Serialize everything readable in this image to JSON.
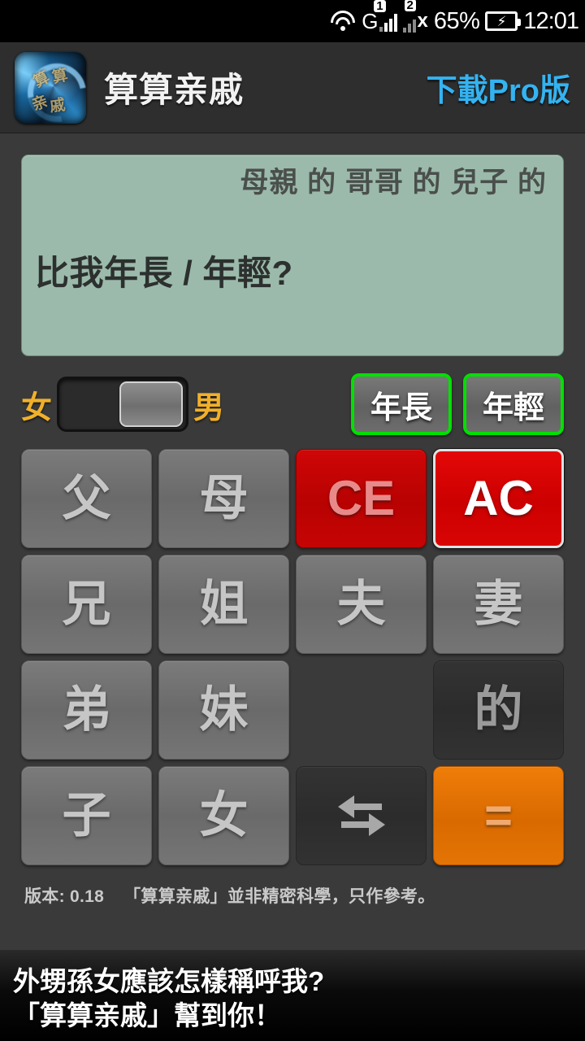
{
  "status_bar": {
    "wifi_icon": "wifi-icon",
    "sim1_label": "G",
    "sim1_badge": "1",
    "sim2_badge": "2",
    "sim2_no_signal": "x",
    "battery_percent": "65%",
    "battery_icon": "battery-charging-icon",
    "time": "12:01"
  },
  "header": {
    "logo_icon": "app-logo-icon",
    "logo_glyphs": [
      "算",
      "算",
      "亲",
      "戚"
    ],
    "title": "算算亲戚",
    "pro_link": "下載Pro版",
    "pro_link_color": "#34b3f1"
  },
  "display": {
    "expression": "母親 的 哥哥 的 兒子 的",
    "question": "比我年長 / 年輕?",
    "background_color": "#9bbaab",
    "text_color": "#2c302e"
  },
  "controls": {
    "gender_toggle": {
      "left_label": "女",
      "right_label": "男",
      "selected": "男",
      "label_color": "#f0b02a"
    },
    "age_buttons": [
      {
        "label": "年長",
        "name": "age-older-button",
        "border_color": "#00e000"
      },
      {
        "label": "年輕",
        "name": "age-younger-button",
        "border_color": "#00e000"
      }
    ]
  },
  "keypad": {
    "keys": [
      {
        "label": "父",
        "name": "key-father",
        "state": "normal"
      },
      {
        "label": "母",
        "name": "key-mother",
        "state": "normal"
      },
      {
        "label": "CE",
        "name": "key-clear-entry",
        "state": "ce"
      },
      {
        "label": "AC",
        "name": "key-all-clear",
        "state": "ac"
      },
      {
        "label": "兄",
        "name": "key-elder-brother",
        "state": "normal"
      },
      {
        "label": "姐",
        "name": "key-elder-sister",
        "state": "normal"
      },
      {
        "label": "夫",
        "name": "key-husband",
        "state": "normal"
      },
      {
        "label": "妻",
        "name": "key-wife",
        "state": "normal"
      },
      {
        "label": "弟",
        "name": "key-younger-brother",
        "state": "normal"
      },
      {
        "label": "妹",
        "name": "key-younger-sister",
        "state": "normal"
      },
      {
        "label": "",
        "name": "key-empty-slot",
        "state": "blank"
      },
      {
        "label": "的",
        "name": "key-possessive",
        "state": "disabled"
      },
      {
        "label": "子",
        "name": "key-son",
        "state": "normal"
      },
      {
        "label": "女",
        "name": "key-daughter",
        "state": "normal"
      },
      {
        "label": "",
        "name": "key-swap",
        "state": "disabled",
        "icon": "swap-arrows-icon"
      },
      {
        "label": "=",
        "name": "key-equals",
        "state": "eq"
      }
    ]
  },
  "footer": {
    "version": "版本: 0.18",
    "disclaimer": "「算算亲戚」並非精密科學，只作參考。"
  },
  "banner": {
    "line1": "外甥孫女應該怎樣稱呼我?",
    "line2": "「算算亲戚」幫到你！"
  }
}
